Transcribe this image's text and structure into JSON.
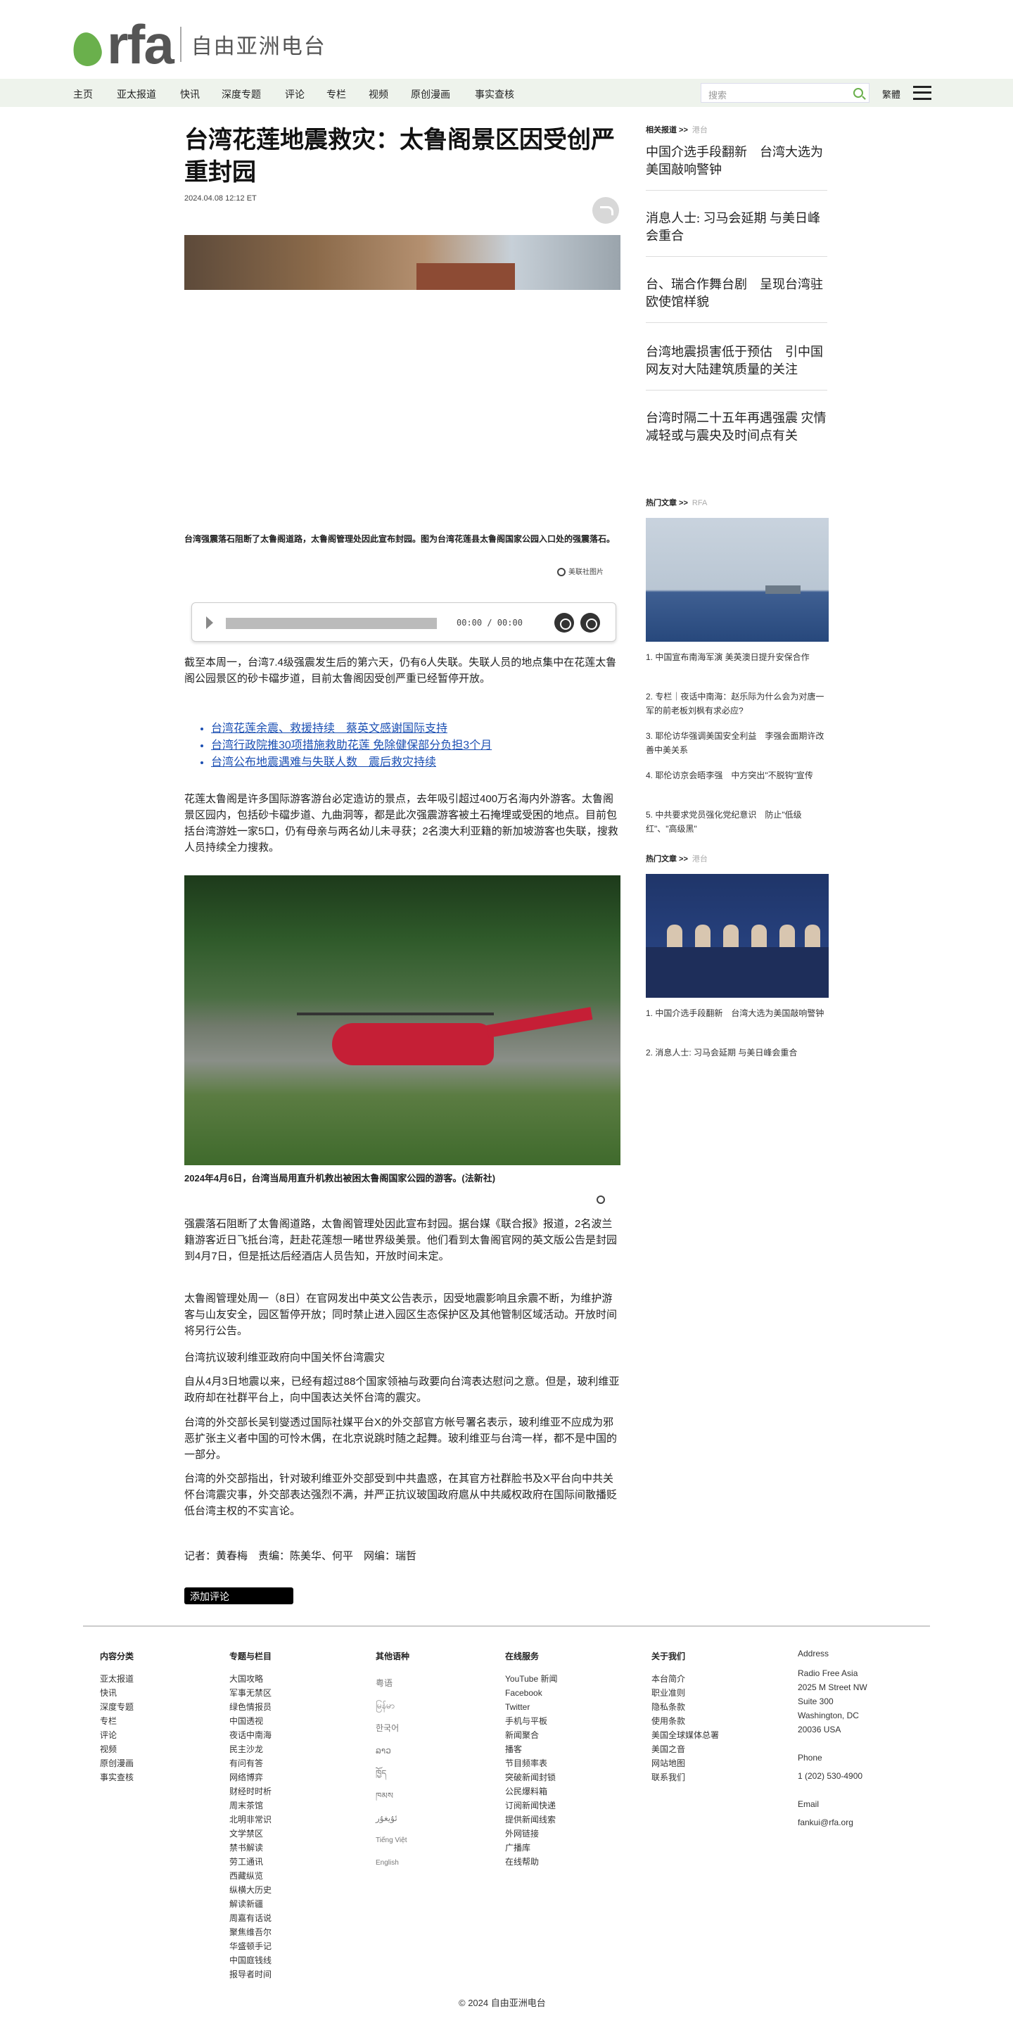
{
  "header": {
    "logo_text": "rfa",
    "logo_cn": "自由亚洲电台"
  },
  "nav": {
    "items": [
      "主页",
      "亚太报道",
      "快讯",
      "深度专题",
      "评论",
      "专栏",
      "视频",
      "原创漫画",
      "事实查核"
    ],
    "search_placeholder": "搜索",
    "lang": "繁體"
  },
  "article": {
    "title": "台湾花莲地震救灾：太鲁阁景区因受创严重封园",
    "date": "2024.04.08 12:12 ET",
    "caption1": "台湾强震落石阻断了太鲁阁道路，太鲁阁管理处因此宣布封园。图为台湾花莲县太鲁阁国家公园入口处的强震落石。",
    "credit1": "美联社图片",
    "audio_time": "00:00 / 00:00",
    "p1": "截至本周一，台湾7.4级强震发生后的第六天，仍有6人失联。失联人员的地点集中在花莲太鲁阁公园景区的砂卡礑步道，目前太鲁阁因受创严重已经暂停开放。",
    "links": [
      "台湾花莲余震、救援持续　蔡英文感谢国际支持",
      "台湾行政院推30项措施救助花莲 免除健保部分负担3个月",
      "台湾公布地震遇难与失联人数　震后救灾持续"
    ],
    "p2": "花莲太鲁阁是许多国际游客游台必定造访的景点，去年吸引超过400万名海内外游客。太鲁阁景区园内，包括砂卡礑步道、九曲洞等，都是此次强震游客被土石掩埋或受困的地点。目前包括台湾游姓一家5口，仍有母亲与两名幼儿未寻获；2名澳大利亚籍的新加坡游客也失联，搜救人员持续全力搜救。",
    "caption2": "2024年4月6日，台湾当局用直升机救出被困太鲁阁国家公园的游客。(法新社)",
    "p3": "强震落石阻断了太鲁阁道路，太鲁阁管理处因此宣布封园。据台媒《联合报》报道，2名波兰籍游客近日飞抵台湾，赶赴花莲想一睹世界级美景。他们看到太鲁阁官网的英文版公告是封园到4月7日，但是抵达后经酒店人员告知，开放时间未定。",
    "p4": "太鲁阁管理处周一（8日）在官网发出中英文公告表示，因受地震影响且余震不断，为维护游客与山友安全，园区暂停开放；同时禁止进入园区生态保护区及其他管制区域活动。开放时间将另行公告。",
    "h1": "台湾抗议玻利维亚政府向中国关怀台湾震灾",
    "p5": "自从4月3日地震以来，已经有超过88个国家领袖与政要向台湾表达慰问之意。但是，玻利维亚政府却在社群平台上，向中国表达关怀台湾的震灾。",
    "p6": "台湾的外交部长吴钊燮透过国际社媒平台X的外交部官方帐号署名表示，玻利维亚不应成为邪恶扩张主义者中国的可怜木偶，在北京说跳时随之起舞。玻利维亚与台湾一样，都不是中国的一部分。",
    "p7": "台湾的外交部指出，针对玻利维亚外交部受到中共蛊惑，在其官方社群脸书及X平台向中共关怀台湾震灾事，外交部表达强烈不满，并严正抗议玻国政府扈从中共威权政府在国际间散播贬低台湾主权的不实言论。",
    "byline": "记者：黄春梅　责编：陈美华、何平　网编：瑞哲",
    "comment_btn": "添加评论"
  },
  "sidebar": {
    "related_hdr": "相关报道 >>",
    "related_tag": "港台",
    "related": [
      "中国介选手段翻新　台湾大选为美国敲响警钟",
      "消息人士: 习马会延期 与美日峰会重合",
      "台、瑞合作舞台剧　呈现台湾驻欧使馆样貌",
      "台湾地震损害低于预估　引中国网友对大陆建筑质量的关注",
      "台湾时隔二十五年再遇强震 灾情减轻或与震央及时间点有关"
    ],
    "hot_hdr": "热门文章 >>",
    "hot_tag": "RFA",
    "hot": [
      "1. 中国宣布南海军演 美英澳日提升安保合作",
      "2. 专栏｜夜话中南海：赵乐际为什么会为对唐一军的前老板刘枫有求必应?",
      "3. 耶伦访华强调美国安全利益　李强会面期许改善中美关系",
      "4. 耶伦访京会晤李强　中方突出\"不脱钩\"宣传",
      "5. 中共要求党员强化党纪意识　防止\"低级红\"、\"高级黑\""
    ],
    "hot2_hdr": "热门文章 >>",
    "hot2_tag": "港台",
    "hot2": [
      "1. 中国介选手段翻新　台湾大选为美国敲响警钟",
      "2. 消息人士: 习马会延期 与美日峰会重合"
    ]
  },
  "footer": {
    "col1_hdr": "内容分类",
    "col1": [
      "亚太报道",
      "快讯",
      "深度专题",
      "专栏",
      "评论",
      "视频",
      "原创漫画",
      "事实查核"
    ],
    "col2_hdr": "专题与栏目",
    "col2": [
      "大国攻略",
      "军事无禁区",
      "绿色情报员",
      "中国透视",
      "夜话中南海",
      "民主沙龙",
      "有问有答",
      "网络博弈",
      "财经时时析",
      "周末茶馆",
      "北明非常识",
      "文学禁区",
      "禁书解读",
      "劳工通讯",
      "西藏纵览",
      "纵横大历史",
      "解读新疆",
      "周嘉有话说",
      "聚焦维吾尔",
      "华盛顿手记",
      "中国庭钱线",
      "报导者时间"
    ],
    "col3_hdr": "其他语种",
    "col3": [
      "粤语",
      "မြန်မာ",
      "한국어",
      "ລາວ",
      "ཁྱོད",
      "ཁམས",
      "ئۇيغۇر",
      "Tiếng Việt",
      "English"
    ],
    "col4_hdr": "在线服务",
    "col4": [
      "YouTube 新闻",
      "Facebook",
      "Twitter",
      "手机与平板",
      "新闻聚合",
      "播客",
      "节目频率表",
      "突破新闻封锁",
      "公民爆料箱",
      "订阅新闻快递",
      "提供新闻线索",
      "外网链接",
      "广播库",
      "在线帮助"
    ],
    "col5_hdr": "关于我们",
    "col5": [
      "本台简介",
      "职业准则",
      "隐私条款",
      "使用条款",
      "美国全球媒体总署",
      "美国之音",
      "网站地图",
      "联系我们"
    ],
    "col6_hdr": "Address",
    "col6": [
      "Radio Free Asia",
      "2025 M Street NW",
      "Suite 300",
      "Washington, DC",
      "20036 USA"
    ],
    "phone_hdr": "Phone",
    "phone": "1 (202) 530-4900",
    "email_hdr": "Email",
    "email": "fankui@rfa.org",
    "copyright": "© 2024 自由亚洲电台"
  }
}
